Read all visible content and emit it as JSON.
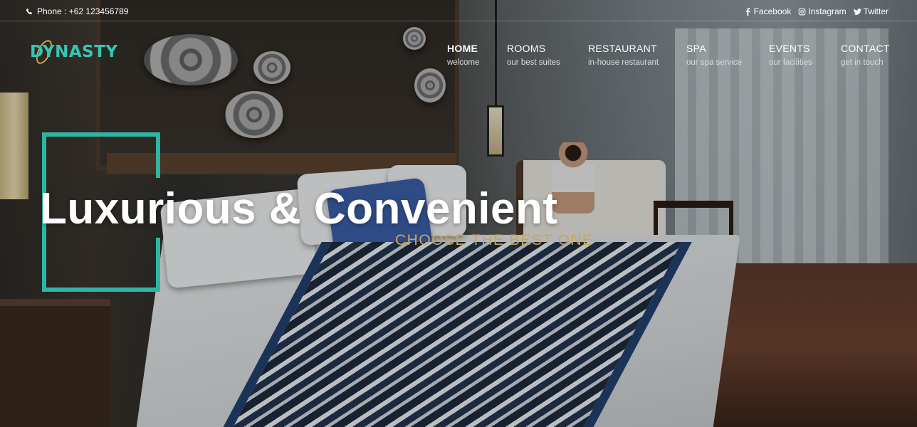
{
  "topbar": {
    "phone": "Phone : +62 123456789",
    "social": [
      {
        "label": "Facebook",
        "icon": "facebook-icon"
      },
      {
        "label": "Instagram",
        "icon": "instagram-icon"
      },
      {
        "label": "Twitter",
        "icon": "twitter-icon"
      }
    ]
  },
  "brand": {
    "logo_text": "DYNASTY",
    "accent_color": "#35c6b4",
    "gold_color": "#c9a656"
  },
  "nav": [
    {
      "label": "HOME",
      "sub": "welcome",
      "active": true
    },
    {
      "label": "ROOMS",
      "sub": "our best suites",
      "active": false
    },
    {
      "label": "RESTAURANT",
      "sub": "in-house restaurant",
      "active": false
    },
    {
      "label": "SPA",
      "sub": "our spa service",
      "active": false
    },
    {
      "label": "EVENTS",
      "sub": "our facilities",
      "active": false
    },
    {
      "label": "CONTACT",
      "sub": "get in touch",
      "active": false
    }
  ],
  "hero": {
    "title": "Luxurious & Convenient",
    "subtitle": "CHOOSE THE BEST ONE"
  }
}
